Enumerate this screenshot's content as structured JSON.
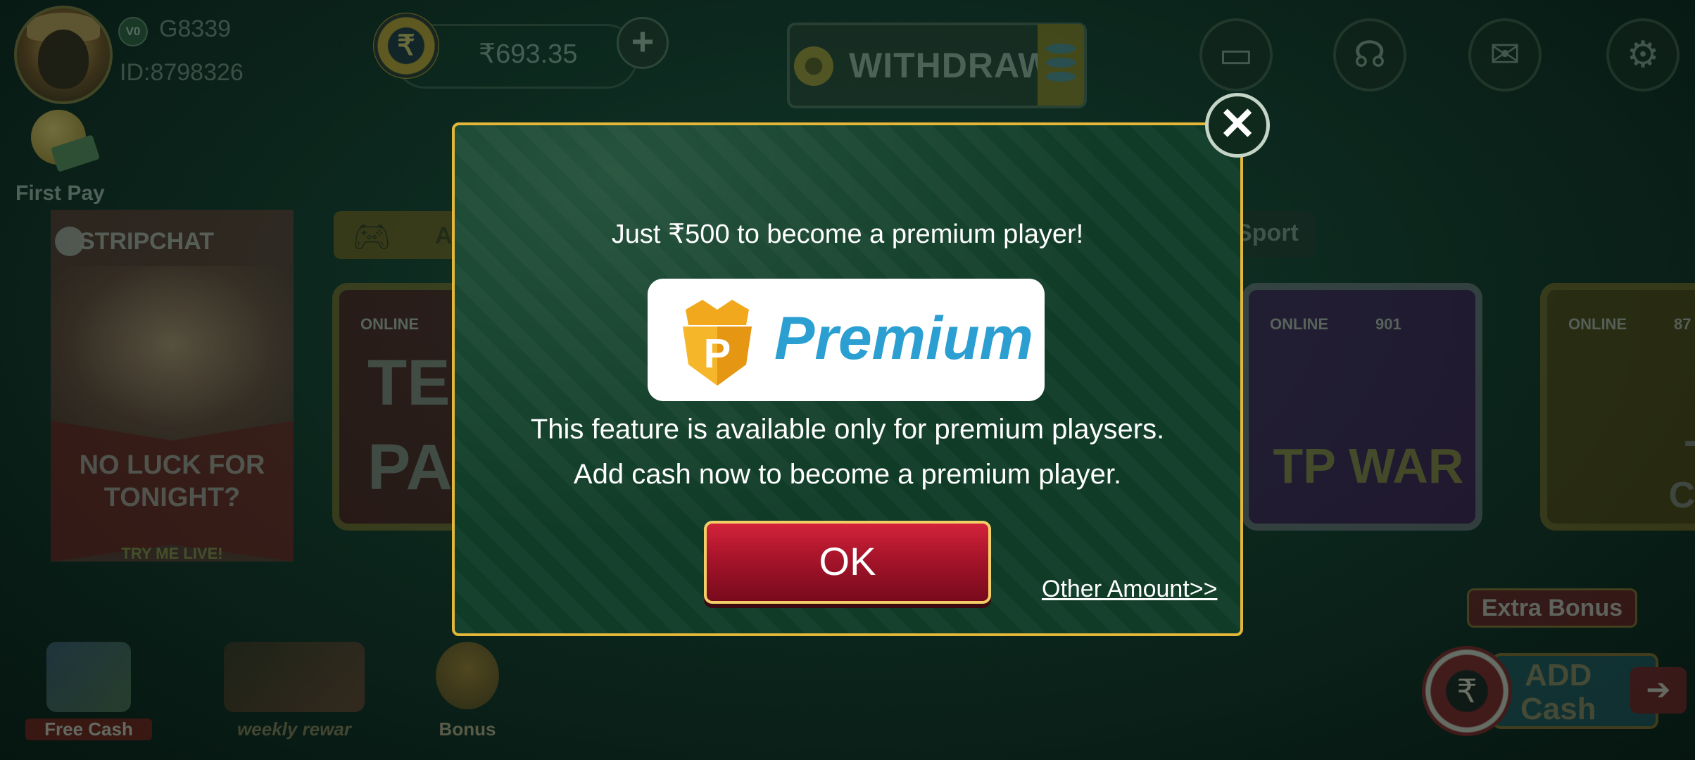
{
  "header": {
    "vip_badge": "V0",
    "username": "G8339",
    "user_id": "ID:8798326",
    "balance": "₹693.35",
    "currency_symbol": "₹",
    "plus": "+",
    "withdraw_label": "WITHDRAW",
    "icons": [
      "cards-icon",
      "support-icon",
      "mail-icon",
      "settings-icon"
    ]
  },
  "first_pay": {
    "label": "First Pay"
  },
  "ad": {
    "brand": "STRIPCHAT",
    "headline": "NO LUCK FOR TONIGHT?",
    "cta": "TRY ME LIVE!"
  },
  "tabs": {
    "all_partial": "A",
    "sport_partial": "Sport"
  },
  "games": [
    {
      "online_label": "ONLINE",
      "online_count": "",
      "title_line1": "TE",
      "title_line2": "PA"
    },
    {
      "online_label": "ONLINE",
      "online_count": "901",
      "title_line1": "TP WAR",
      "title_line2": ""
    },
    {
      "online_label": "ONLINE",
      "online_count": "87",
      "title_line1": "TEX",
      "title_line2": "CowB"
    }
  ],
  "bottom": {
    "free_cash": "Free Cash",
    "weekly_reward": "weekly rewar",
    "bonus": "Bonus",
    "extra_bonus": "Extra Bonus",
    "add_cash_line1": "ADD",
    "add_cash_line2": "Cash",
    "add_cash_symbol": "₹",
    "add_cash_arrow": "➔"
  },
  "modal": {
    "close": "✕",
    "title": "Just ₹500    to become a premium player!",
    "badge_letter": "P",
    "premium_word": "Premium",
    "line1": "This feature is available only for premium playsers.",
    "line2": "Add cash now to become a premium player.",
    "ok": "OK",
    "other_amount": "Other Amount>>"
  },
  "colors": {
    "modal_border": "#e4b73b",
    "modal_bg": "#0f3b27",
    "ok_red": "#a6142a",
    "premium_blue": "#2b9fd1"
  }
}
